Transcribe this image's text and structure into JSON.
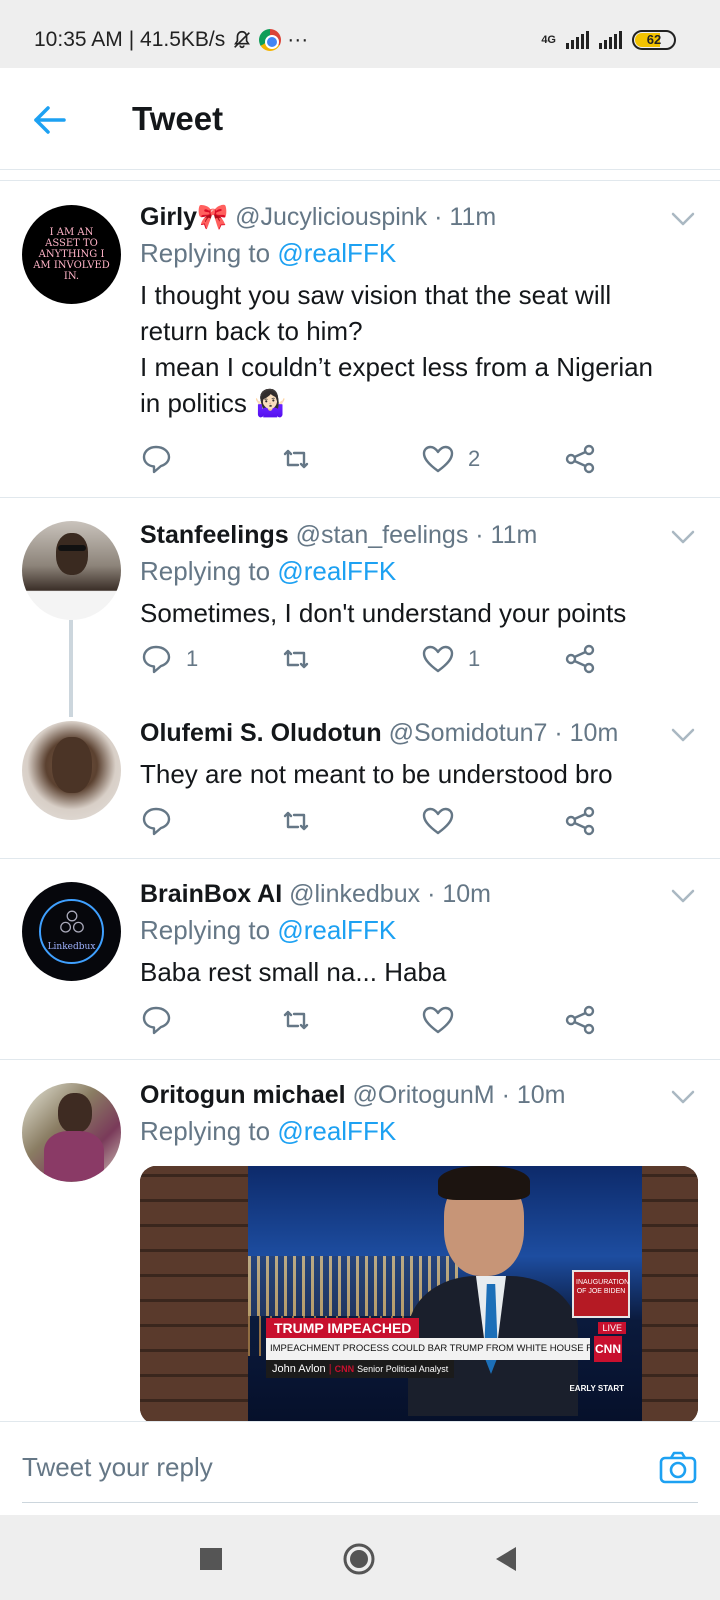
{
  "status_bar": {
    "time": "10:35 AM",
    "speed": "| 41.5KB/s",
    "network": "4G",
    "battery": "62"
  },
  "header": {
    "title": "Tweet"
  },
  "tweets": [
    {
      "name": "Girly🎀",
      "handle": "@Jucyliciouspink",
      "time": "· 11m",
      "reply_label": "Replying to",
      "reply_handle": "@realFFK",
      "text": "I thought you saw vision that the seat will return back to him?\nI mean I couldn’t expect less from a Nigerian in politics 🤷🏻‍♀️",
      "avatar_text": "I AM AN ASSET TO ANYTHING I AM INVOLVED IN.",
      "reply_count": "",
      "like_count": "2"
    },
    {
      "name": "Stanfeelings",
      "handle": "@stan_feelings",
      "time": "· 11m",
      "reply_label": "Replying to",
      "reply_handle": "@realFFK",
      "text": "Sometimes, I don't understand your points",
      "reply_count": "1",
      "like_count": "1"
    },
    {
      "name": "Olufemi S. Oludotun",
      "handle": "@Somidotun7",
      "time": "· 10m",
      "text": "They are not meant to be understood bro",
      "reply_count": "",
      "like_count": ""
    },
    {
      "name": "BrainBox AI",
      "handle": "@linkedbux",
      "time": "· 10m",
      "reply_label": "Replying to",
      "reply_handle": "@realFFK",
      "text": "Baba rest small na... Haba",
      "avatar_text": "Linkedbux",
      "reply_count": "",
      "like_count": ""
    },
    {
      "name": "Oritogun michael",
      "handle": "@OritogunM",
      "time": "· 10m",
      "reply_label": "Replying to",
      "reply_handle": "@realFFK",
      "media": {
        "headline": "TRUMP IMPEACHED",
        "ticker": "IMPEACHMENT PROCESS COULD BAR TRUMP FROM WHITE HOUSE FOREVER",
        "lower_third": "John Avlon",
        "network": "CNN",
        "role": "Senior Political Analyst",
        "live": "LIVE",
        "show": "EARLY START",
        "side_text": "INAUGURATION OF JOE BIDEN"
      }
    }
  ],
  "reply_bar": {
    "placeholder": "Tweet your reply"
  },
  "colors": {
    "accent": "#1da1f2",
    "muted": "#657786",
    "divider": "#e1e8ed"
  },
  "icons": [
    "back-arrow-icon",
    "reply-icon",
    "retweet-icon",
    "like-icon",
    "share-icon",
    "caret-down-icon",
    "camera-icon",
    "recent-apps-icon",
    "home-icon",
    "back-nav-icon"
  ]
}
